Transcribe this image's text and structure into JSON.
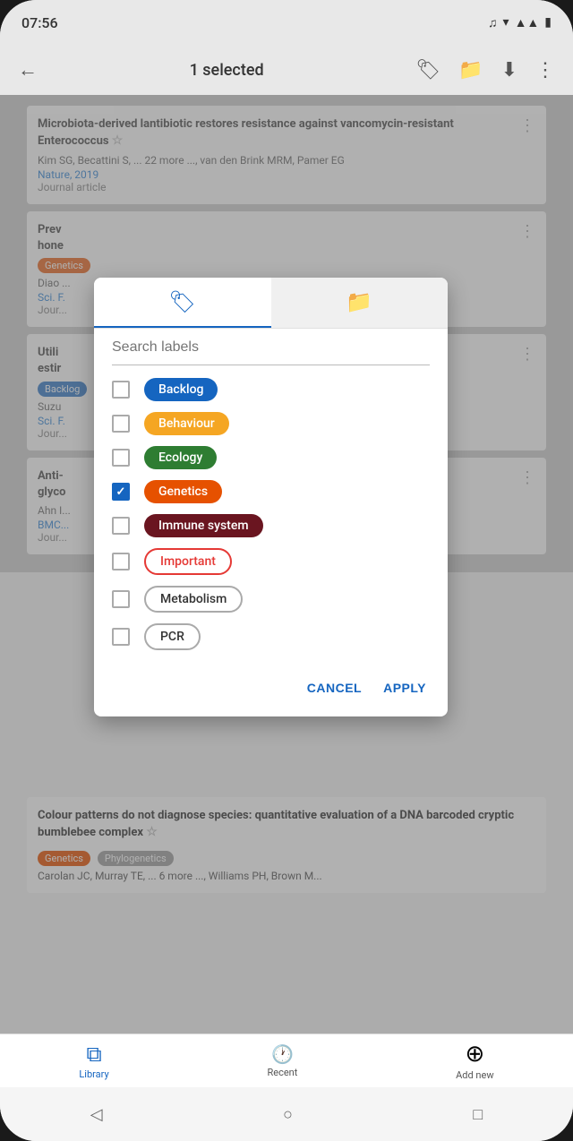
{
  "statusBar": {
    "time": "07:56",
    "spotifyIcon": "♫",
    "wifiIcon": "▼",
    "signalIcon": "▲",
    "batteryIcon": "▮"
  },
  "appBar": {
    "backIcon": "←",
    "title": "1 selected",
    "labelIcon": "🏷",
    "folderIcon": "📁",
    "downloadIcon": "⬇",
    "moreIcon": "⋮"
  },
  "articles": [
    {
      "title": "Microbiota-derived lantibiotic restores resistance against vancomycin-resistant Enterococcus ☆",
      "authors": "Kim SG, Becattini S, ... 22 more ..., van den Brink MRM, Pamer EG",
      "journal": "Nature, 2019",
      "type": "Journal article"
    },
    {
      "tag": "Genetics",
      "tagClass": "tag-genetics",
      "titleStart": "Prev",
      "titleMiddle": "hone",
      "authors": "Diao ...",
      "journal": "Sci. F.",
      "type": "Jour..."
    },
    {
      "tag": "Backlog",
      "tagClass": "tag-backlog",
      "titleStart": "Utili",
      "titleMiddle": "estir",
      "authors": "Suzu",
      "journal": "Sci. F.",
      "type": "Jour..."
    },
    {
      "titleStart": "Anti-",
      "titleMiddle": "glyco",
      "authors": "Ahn I...",
      "journal": "BMC...",
      "type": "Jour..."
    }
  ],
  "bottomArticle": {
    "title": "Colour patterns do not diagnose species: quantitative evaluation of a DNA barcoded cryptic bumblebee complex ☆",
    "tag1": "Genetics",
    "tag1Class": "tag-genetics",
    "tag2": "Phylogenetics",
    "tag2Class": "tag-phylogenetics",
    "authors": "Carolan JC, Murray TE, ... 6 more ..., Williams PH, Brown M..."
  },
  "dialog": {
    "tab1Icon": "🏷",
    "tab2Icon": "📁",
    "searchPlaceholder": "Search labels",
    "labels": [
      {
        "id": "backlog",
        "text": "Backlog",
        "badgeClass": "label-backlog",
        "checked": false
      },
      {
        "id": "behaviour",
        "text": "Behaviour",
        "badgeClass": "label-behaviour",
        "checked": false
      },
      {
        "id": "ecology",
        "text": "Ecology",
        "badgeClass": "label-ecology",
        "checked": false
      },
      {
        "id": "genetics",
        "text": "Genetics",
        "badgeClass": "label-genetics-badge",
        "checked": true
      },
      {
        "id": "immune",
        "text": "Immune system",
        "badgeClass": "label-immune",
        "checked": false
      },
      {
        "id": "important",
        "text": "Important",
        "badgeClass": "label-important",
        "checked": false
      },
      {
        "id": "metabolism",
        "text": "Metabolism",
        "badgeClass": "label-metabolism",
        "checked": false
      },
      {
        "id": "pcr",
        "text": "PCR",
        "badgeClass": "label-pcr",
        "checked": false
      }
    ],
    "cancelLabel": "CANCEL",
    "applyLabel": "APPLY"
  },
  "bottomNav": [
    {
      "icon": "⧉",
      "label": "Library",
      "active": true
    },
    {
      "icon": "🕐",
      "label": "Recent",
      "active": false
    },
    {
      "icon": "⊕",
      "label": "Add new",
      "active": false
    }
  ],
  "systemNav": {
    "backIcon": "◁",
    "homeIcon": "○",
    "recentsIcon": "□"
  }
}
